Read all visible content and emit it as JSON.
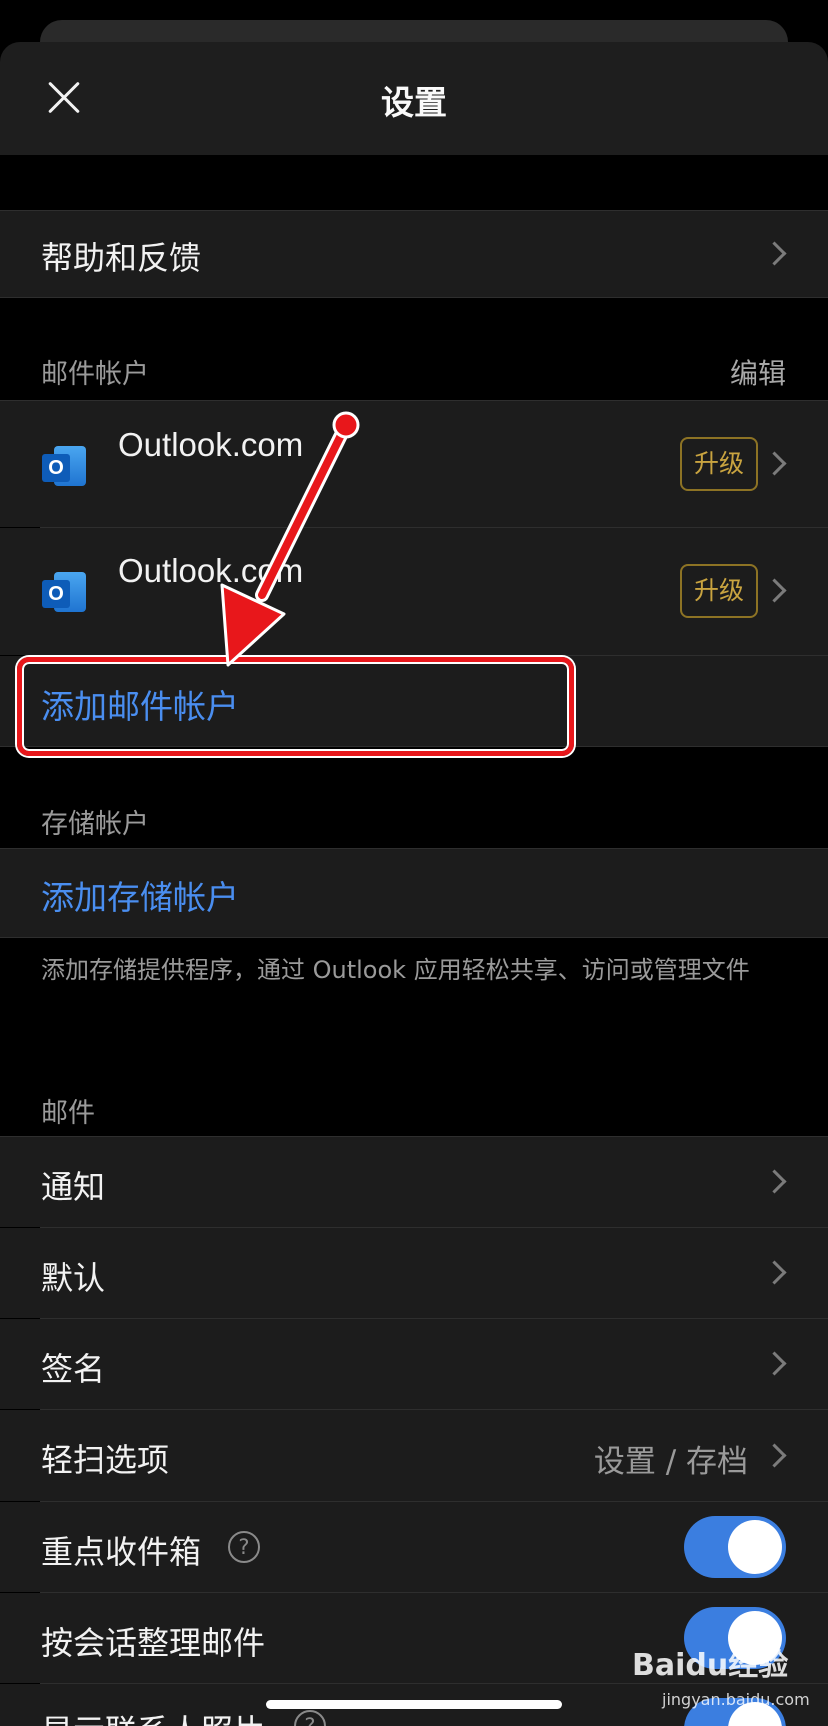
{
  "header": {
    "title": "设置"
  },
  "help_row": {
    "label": "帮助和反馈"
  },
  "mail_accounts": {
    "section_title": "邮件帐户",
    "edit_label": "编辑",
    "accounts": [
      {
        "name": "Outlook.com",
        "icon_glyph": "O",
        "badge": "升级"
      },
      {
        "name": "Outlook.com",
        "icon_glyph": "O",
        "badge": "升级"
      }
    ],
    "add_label": "添加邮件帐户"
  },
  "storage_accounts": {
    "section_title": "存储帐户",
    "add_label": "添加存储帐户",
    "footnote": "添加存储提供程序，通过 Outlook 应用轻松共享、访问或管理文件"
  },
  "mail": {
    "section_title": "邮件",
    "items": [
      {
        "label": "通知"
      },
      {
        "label": "默认"
      },
      {
        "label": "签名"
      },
      {
        "label": "轻扫选项",
        "value": "设置 / 存档"
      },
      {
        "label": "重点收件箱",
        "help_glyph": "?",
        "toggle": true
      },
      {
        "label": "按会话整理邮件",
        "toggle": true
      },
      {
        "label": "显示联系人照片",
        "help_glyph": "?",
        "toggle": true
      }
    ]
  },
  "watermark": {
    "brand": "Baidu经验",
    "url": "jingyan.baidu.com"
  },
  "colors": {
    "accent_blue": "#4a8ef0",
    "toggle_on": "#3b7ee0",
    "upgrade_gold": "#c9a440",
    "annotation_red": "#e8171b"
  }
}
